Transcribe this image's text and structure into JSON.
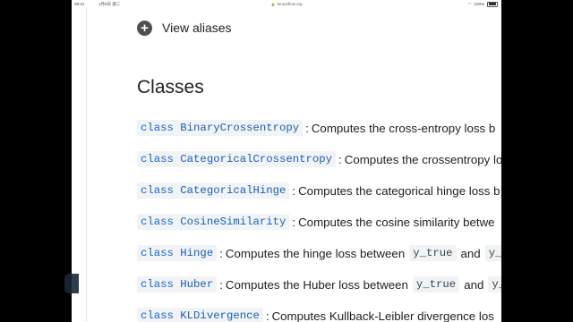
{
  "status_bar": {
    "time": "09:41",
    "date": "1月9日 週二",
    "url": "tensorflow.org",
    "battery": "100%"
  },
  "aliases": {
    "label": "View aliases"
  },
  "section": {
    "title": "Classes"
  },
  "classes": [
    {
      "keyword": "class",
      "name": "BinaryCrossentropy",
      "desc": "Computes the cross-entropy loss b"
    },
    {
      "keyword": "class",
      "name": "CategoricalCrossentropy",
      "desc": "Computes the crossentropy lo"
    },
    {
      "keyword": "class",
      "name": "CategoricalHinge",
      "desc": "Computes the categorical hinge loss b"
    },
    {
      "keyword": "class",
      "name": "CosineSimilarity",
      "desc": "Computes the cosine similarity betwe"
    },
    {
      "keyword": "class",
      "name": "Hinge",
      "desc": "Computes the hinge loss between",
      "arg1": "y_true",
      "and": "and",
      "arg2": "y_"
    },
    {
      "keyword": "class",
      "name": "Huber",
      "desc": "Computes the Huber loss between",
      "arg1": "y_true",
      "and": "and",
      "arg2": "y_"
    },
    {
      "keyword": "class",
      "name": "KLDivergence",
      "desc": "Computes Kullback-Leibler divergence los"
    }
  ],
  "colors": {
    "link": "#1a5fb4",
    "code_bg": "#f1f3f4",
    "text": "#202124",
    "outer": "#000000"
  }
}
